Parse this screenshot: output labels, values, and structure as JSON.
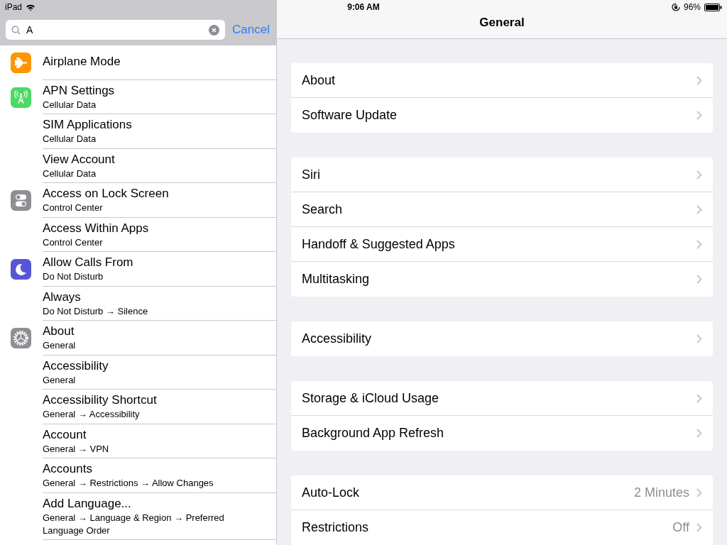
{
  "status_bar": {
    "device": "iPad",
    "time": "9:06 AM",
    "battery": "96%"
  },
  "search": {
    "value": "A",
    "cancel": "Cancel"
  },
  "results": [
    {
      "title": "Airplane Mode",
      "kind": "airplane"
    },
    {
      "title": "APN Settings",
      "subtitle": "Cellular Data",
      "kind": "cellular"
    },
    {
      "title": "SIM Applications",
      "subtitle": "Cellular Data"
    },
    {
      "title": "View Account",
      "subtitle": "Cellular Data"
    },
    {
      "title": "Access on Lock Screen",
      "subtitle": "Control Center",
      "kind": "toggles"
    },
    {
      "title": "Access Within Apps",
      "subtitle": "Control Center"
    },
    {
      "title": "Allow Calls From",
      "subtitle": "Do Not Disturb",
      "kind": "moon"
    },
    {
      "title": "Always",
      "subtitle": "Do Not Disturb → Silence"
    },
    {
      "title": "About",
      "subtitle": "General",
      "kind": "gear"
    },
    {
      "title": "Accessibility",
      "subtitle": "General"
    },
    {
      "title": "Accessibility Shortcut",
      "subtitle": "General → Accessibility"
    },
    {
      "title": "Account",
      "subtitle": "General → VPN"
    },
    {
      "title": "Accounts",
      "subtitle": "General → Restrictions → Allow Changes"
    },
    {
      "title": "Add Language...",
      "subtitle": "General → Language & Region → Preferred Language Order"
    }
  ],
  "detail": {
    "title": "General",
    "groups": [
      [
        {
          "label": "About"
        },
        {
          "label": "Software Update"
        }
      ],
      [
        {
          "label": "Siri"
        },
        {
          "label": "Search"
        },
        {
          "label": "Handoff & Suggested Apps"
        },
        {
          "label": "Multitasking"
        }
      ],
      [
        {
          "label": "Accessibility"
        }
      ],
      [
        {
          "label": "Storage & iCloud Usage"
        },
        {
          "label": "Background App Refresh"
        }
      ],
      [
        {
          "label": "Auto-Lock",
          "value": "2 Minutes"
        },
        {
          "label": "Restrictions",
          "value": "Off"
        }
      ]
    ]
  }
}
